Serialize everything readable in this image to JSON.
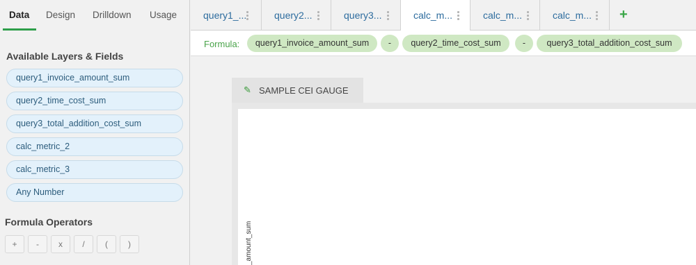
{
  "left_tabs": [
    {
      "label": "Data",
      "active": true
    },
    {
      "label": "Design"
    },
    {
      "label": "Drilldown"
    },
    {
      "label": "Usage"
    }
  ],
  "layers": {
    "title": "Available Layers & Fields",
    "fields": [
      "query1_invoice_amount_sum",
      "query2_time_cost_sum",
      "query3_total_addition_cost_sum",
      "calc_metric_2",
      "calc_metric_3",
      "Any Number"
    ]
  },
  "operators": {
    "title": "Formula Operators",
    "items": [
      "+",
      "-",
      "x",
      "/",
      "(",
      ")"
    ]
  },
  "top_tabs": [
    {
      "label": "query1_..."
    },
    {
      "label": "query2..."
    },
    {
      "label": "query3..."
    },
    {
      "label": "calc_m...",
      "active": true
    },
    {
      "label": "calc_m..."
    },
    {
      "label": "calc_m..."
    }
  ],
  "add_tab_icon": "plus-icon",
  "formula": {
    "label": "Formula:",
    "tokens": [
      "query1_invoice_amount_sum",
      "-",
      "query2_time_cost_sum",
      "-",
      "query3_total_addition_cost_sum"
    ]
  },
  "widget": {
    "title": "SAMPLE CEI GAUGE",
    "edit_icon": "pencil-icon",
    "y_axis_label": "_amount_sum"
  },
  "colors": {
    "accent_green": "#2e9e4a",
    "chip_green": "#cfe8c3",
    "field_blue": "#e3f1fb",
    "tab_text_blue": "#2d6c9e"
  }
}
